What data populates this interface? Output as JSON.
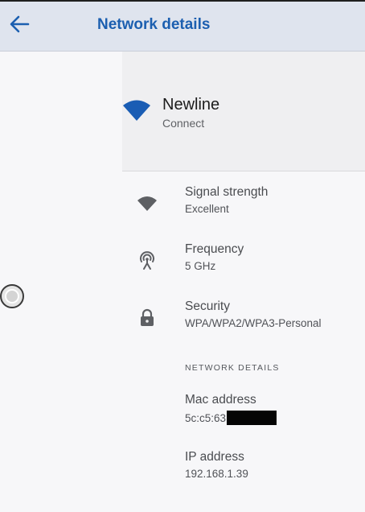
{
  "header": {
    "title": "Network details",
    "back_icon": "arrow-left-icon",
    "accent_color": "#1c5fb0"
  },
  "network": {
    "name": "Newline",
    "status": "Connect",
    "icon": "wifi-icon"
  },
  "details": {
    "signal": {
      "label": "Signal strength",
      "value": "Excellent",
      "icon": "wifi-signal-icon"
    },
    "frequency": {
      "label": "Frequency",
      "value": "5 GHz",
      "icon": "antenna-icon"
    },
    "security": {
      "label": "Security",
      "value": "WPA/WPA2/WPA3-Personal",
      "icon": "lock-icon"
    }
  },
  "network_details": {
    "heading": "NETWORK DETAILS",
    "mac": {
      "label": "Mac address",
      "value_prefix": "5c:c5:63"
    },
    "ip": {
      "label": "IP address",
      "value": "192.168.1.39"
    }
  }
}
